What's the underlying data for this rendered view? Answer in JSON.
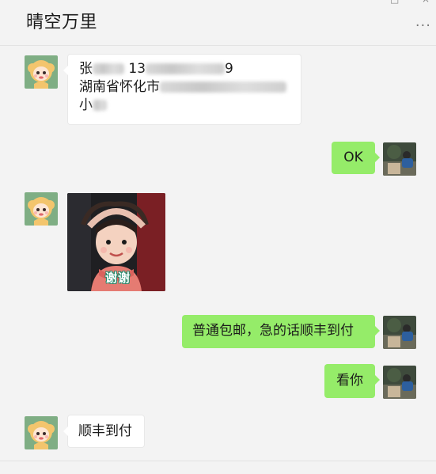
{
  "window": {
    "title": "晴空万里",
    "more_label": "···"
  },
  "messages": [
    {
      "side": "left",
      "line1_text": "张",
      "line1_phone": "13",
      "line1_phone_tail": "9",
      "line2_text": "湖南省怀化市",
      "line3_text": "小"
    },
    {
      "side": "right",
      "text": "OK"
    },
    {
      "side": "left",
      "sticker_text": "谢谢"
    },
    {
      "side": "right",
      "text": "普通包邮，急的话顺丰到付"
    },
    {
      "side": "right",
      "text": "看你"
    },
    {
      "side": "left",
      "text": "顺丰到付"
    }
  ],
  "colors": {
    "bg": "#f3f3f3",
    "right_bubble": "#95ec69",
    "left_bubble": "#ffffff"
  }
}
